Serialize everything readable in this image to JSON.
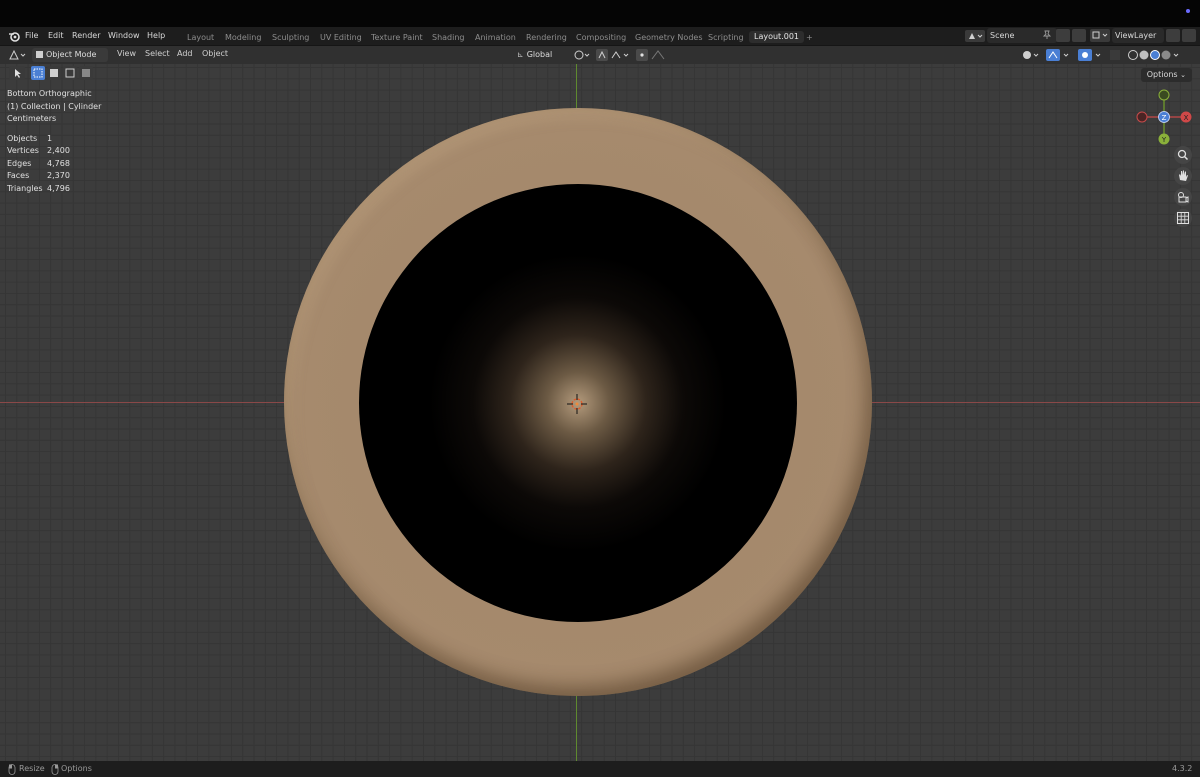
{
  "menu": {
    "file": "File",
    "edit": "Edit",
    "render": "Render",
    "window": "Window",
    "help": "Help"
  },
  "workspace_tabs": [
    "Layout",
    "Modeling",
    "Sculpting",
    "UV Editing",
    "Texture Paint",
    "Shading",
    "Animation",
    "Rendering",
    "Compositing",
    "Geometry Nodes",
    "Scripting",
    "Layout.001"
  ],
  "add_tab_label": "+",
  "scene": {
    "name": "Scene"
  },
  "view_layer": {
    "name": "ViewLayer"
  },
  "header": {
    "mode": "Object Mode",
    "view": "View",
    "select": "Select",
    "add": "Add",
    "object": "Object",
    "orientation": "Global"
  },
  "viewport": {
    "view_name": "Bottom Orthographic",
    "collection_line": "(1) Collection | Cylinder",
    "units": "Centimeters",
    "stats": [
      {
        "label": "Objects",
        "value": "1"
      },
      {
        "label": "Vertices",
        "value": "2,400"
      },
      {
        "label": "Edges",
        "value": "4,768"
      },
      {
        "label": "Faces",
        "value": "2,370"
      },
      {
        "label": "Triangles",
        "value": "4,796"
      }
    ],
    "options_label": "Options",
    "gizmo": {
      "x": "X",
      "y": "Y",
      "z": "Z"
    }
  },
  "status_bar": {
    "resize": "Resize",
    "options": "Options",
    "version": "4.3.2"
  },
  "colors": {
    "axis_x": "#8a4848",
    "axis_y": "#5f8a2f",
    "accent_blue": "#4a7fd4",
    "mesh": "#a1866a"
  }
}
